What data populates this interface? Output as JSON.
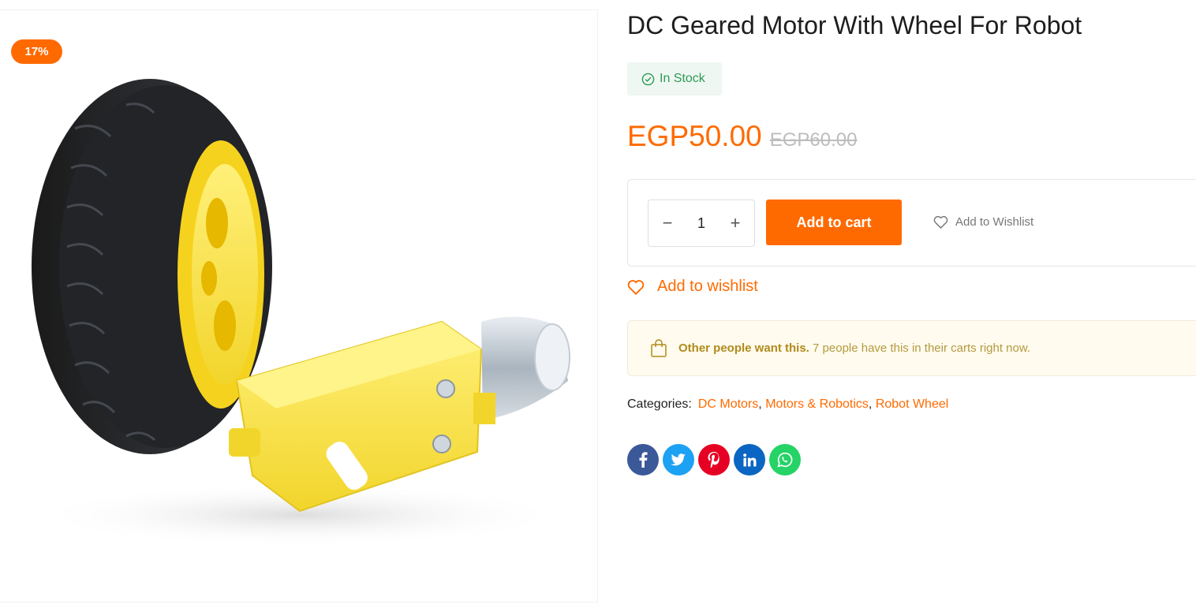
{
  "product": {
    "sale_badge": "17%",
    "title": "DC Geared Motor With Wheel For Robot",
    "stock_label": "In Stock",
    "price_current": "EGP50.00",
    "price_old": "EGP60.00",
    "quantity": "1",
    "add_to_cart_label": "Add to cart",
    "wishlist_small_label": "Add to Wishlist",
    "wishlist_large_label": "Add to wishlist"
  },
  "notice": {
    "bold": "Other people want this.",
    "text": "7 people have this in their carts right now."
  },
  "categories": {
    "label": "Categories:",
    "items": [
      "DC Motors",
      "Motors & Robotics",
      "Robot Wheel"
    ],
    "separator": ","
  },
  "share": {
    "items": [
      {
        "icon": "facebook-icon",
        "glyph": "f",
        "color": "#3b5998"
      },
      {
        "icon": "twitter-icon",
        "glyph": "t",
        "color": "#1da1f2"
      },
      {
        "icon": "pinterest-icon",
        "glyph": "p",
        "color": "#e60023"
      },
      {
        "icon": "linkedin-icon",
        "glyph": "in",
        "color": "#0a66c2"
      },
      {
        "icon": "whatsapp-icon",
        "glyph": "w",
        "color": "#25d366"
      }
    ]
  },
  "colors": {
    "accent": "#ff6a00",
    "stock_green": "#2f9a57",
    "notice_bg": "#fffbee"
  }
}
